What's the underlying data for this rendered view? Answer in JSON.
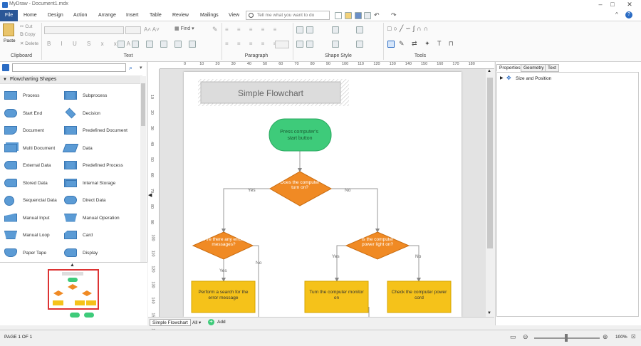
{
  "app": {
    "title": "MyDraw - Document1.mdx"
  },
  "menu": {
    "items": [
      "File",
      "Home",
      "Design",
      "Action",
      "Arrange",
      "Insert",
      "Table",
      "Review",
      "Mailings",
      "View"
    ],
    "tell_placeholder": "Tell me what you want to do"
  },
  "ribbon": {
    "paste_label": "Paste",
    "cut_label": "Cut",
    "copy_label": "Copy",
    "delete_label": "Delete",
    "find_label": "Find",
    "groups": [
      "Clipboard",
      "Text",
      "Paragraph",
      "Shape Style",
      "Tools"
    ]
  },
  "shapes_panel": {
    "section_title": "Flowcharting Shapes",
    "items": [
      [
        "Process",
        "Subprocess"
      ],
      [
        "Start End",
        "Decision"
      ],
      [
        "Document",
        "Predefined Document"
      ],
      [
        "Multi Document",
        "Data"
      ],
      [
        "External Data",
        "Predefined Process"
      ],
      [
        "Stored Data",
        "Internal Storage"
      ],
      [
        "Sequencial Data",
        "Direct Data"
      ],
      [
        "Manual Input",
        "Manual Operation"
      ],
      [
        "Manual Loop",
        "Card"
      ],
      [
        "Paper Tape",
        "Display"
      ]
    ]
  },
  "ruler": {
    "top": [
      "0",
      "10",
      "20",
      "30",
      "40",
      "50",
      "60",
      "70",
      "80",
      "90",
      "100",
      "110",
      "120",
      "130",
      "140",
      "150",
      "160",
      "170",
      "180"
    ],
    "left": [
      "10",
      "20",
      "30",
      "40",
      "50",
      "60",
      "70",
      "80",
      "90",
      "100",
      "110",
      "120",
      "130",
      "140",
      "150",
      "160"
    ]
  },
  "flowchart": {
    "title": "Simple Flowchart",
    "start": "Press computer's start button",
    "decision1": "Does the computer turn on?",
    "yes1": "Yes",
    "no1": "No",
    "decision2": "Are there any error messages?",
    "decision3": "Is the computer power light on?",
    "yes2": "Yes",
    "no2": "No",
    "yes3": "Yes",
    "no3": "No",
    "process1": "Perform a search for the error message",
    "process2": "Turn the computer monitor on",
    "process3": "Check the computer power cord"
  },
  "colors": {
    "green": "#3ecb7a",
    "orange": "#f08a24",
    "yellow": "#f5c21a",
    "shape_blue": "#5b9bd5",
    "file_blue": "#2b5797"
  },
  "tabs": {
    "page_tab": "Simple Flowchart",
    "all_label": "All",
    "add_label": "Add"
  },
  "right_panel": {
    "tabs": [
      "Properties",
      "Geometry",
      "Text"
    ],
    "item": "Size and Position"
  },
  "status": {
    "page": "PAGE 1 OF 1",
    "zoom": "100%"
  }
}
